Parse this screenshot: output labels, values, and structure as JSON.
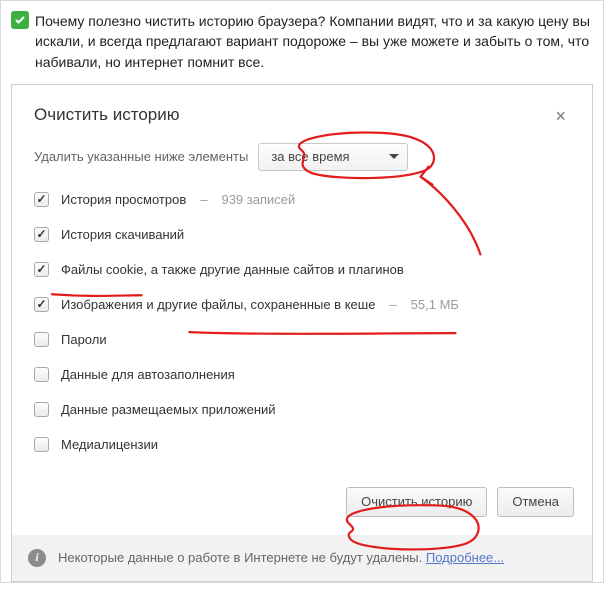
{
  "intro": {
    "text": "Почему полезно чистить историю браузера? Компании видят, что и за какую цену вы искали, и всегда предлагают вариант подороже – вы уже можете и забыть о том, что набивали, но интернет помнит все."
  },
  "dialog": {
    "title": "Очистить историю",
    "close_glyph": "×",
    "period_label": "Удалить указанные ниже элементы",
    "period_value": "за все время"
  },
  "options": [
    {
      "label": "История просмотров",
      "suffix": "939 записей",
      "checked": true
    },
    {
      "label": "История скачиваний",
      "suffix": "",
      "checked": true
    },
    {
      "label": "Файлы cookie, а также другие данные сайтов и плагинов",
      "suffix": "",
      "checked": true
    },
    {
      "label": "Изображения и другие файлы, сохраненные в кеше",
      "suffix": "55,1 МБ",
      "checked": true
    },
    {
      "label": "Пароли",
      "suffix": "",
      "checked": false
    },
    {
      "label": "Данные для автозаполнения",
      "suffix": "",
      "checked": false
    },
    {
      "label": "Данные размещаемых приложений",
      "suffix": "",
      "checked": false
    },
    {
      "label": "Медиалицензии",
      "suffix": "",
      "checked": false
    }
  ],
  "footer": {
    "primary": "Очистить историю",
    "cancel": "Отмена"
  },
  "note": {
    "text": "Некоторые данные о работе в Интернете не будут удалены.",
    "link": "Подробнее..."
  }
}
